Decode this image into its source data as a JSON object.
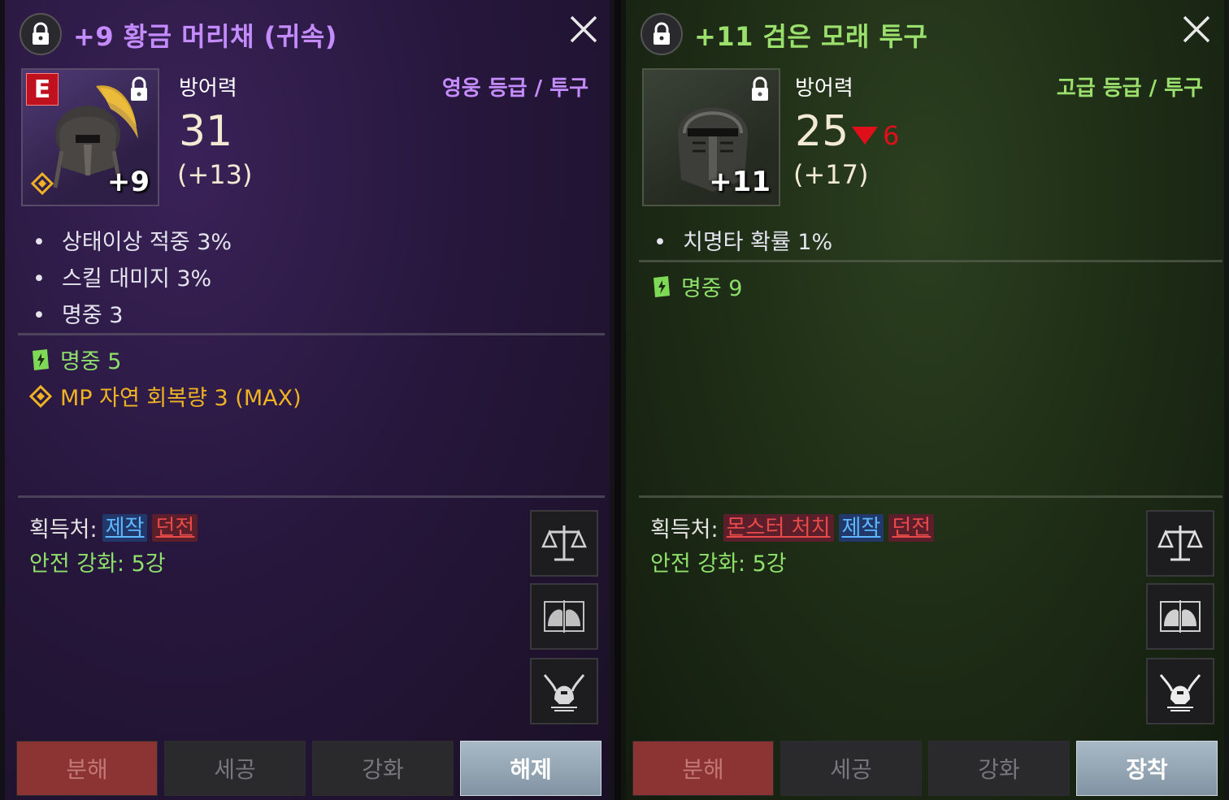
{
  "colors": {
    "heroic": "#c58cff",
    "advanced": "#9be06d",
    "accent_green": "#8ee06a",
    "gold": "#f0b323",
    "decrease_red": "#e0101a"
  },
  "left": {
    "title": "+9 황금 머리채 (귀속)",
    "badge": "E",
    "enhance_label": "+9",
    "stat_label": "방어력",
    "grade": "영웅 등급 / 투구",
    "stat_value": "31",
    "stat_bonus": "(+13)",
    "options": [
      "상태이상 적중 3%",
      "스킬 대미지 3%",
      "명중 3"
    ],
    "special_options": [
      {
        "icon": "green-card-icon",
        "text": "명중 5"
      },
      {
        "icon": "gold-diamond-icon",
        "text": "MP 자연 회복량 3 (MAX)"
      }
    ],
    "source_label": "획득처:",
    "sources": [
      {
        "text": "제작",
        "color": "blue"
      },
      {
        "text": "던전",
        "color": "red"
      }
    ],
    "safe_enhance": "안전 강화: 5강",
    "side_buttons": [
      "scale-icon",
      "compare-helmets-icon",
      "winged-helmet-icon"
    ],
    "buttons": [
      "분해",
      "세공",
      "강화",
      "해제"
    ]
  },
  "right": {
    "title": "+11 검은 모래 투구",
    "enhance_label": "+11",
    "stat_label": "방어력",
    "grade": "고급 등급 / 투구",
    "stat_value": "25",
    "stat_delta": "6",
    "stat_bonus": "(+17)",
    "options": [
      "치명타 확률 1%"
    ],
    "special_options": [
      {
        "icon": "green-card-icon",
        "text": "명중 9"
      }
    ],
    "source_label": "획득처:",
    "sources": [
      {
        "text": "몬스터 처치",
        "color": "red"
      },
      {
        "text": "제작",
        "color": "blue"
      },
      {
        "text": "던전",
        "color": "red"
      }
    ],
    "safe_enhance": "안전 강화: 5강",
    "side_buttons": [
      "scale-icon",
      "compare-helmets-icon",
      "winged-helmet-icon"
    ],
    "buttons": [
      "분해",
      "세공",
      "강화",
      "장착"
    ]
  }
}
